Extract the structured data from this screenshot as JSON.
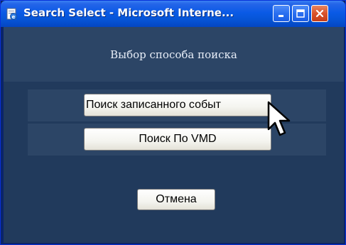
{
  "window": {
    "title": "Search Select - Microsoft Interne...",
    "icons": {
      "app": "ie-page-icon",
      "minimize": "minimize-icon",
      "maximize": "maximize-icon",
      "close": "close-icon"
    }
  },
  "dialog": {
    "heading": "Выбор способа поиска",
    "buttons": {
      "recorded_event": "Поиск записанного событ",
      "vmd": "Поиск По VMD",
      "cancel": "Отмена"
    }
  },
  "colors": {
    "titlebar": "#0a5ae6",
    "background": "#213a5c",
    "row_background": "#2c4566",
    "close_button": "#d9532b"
  }
}
